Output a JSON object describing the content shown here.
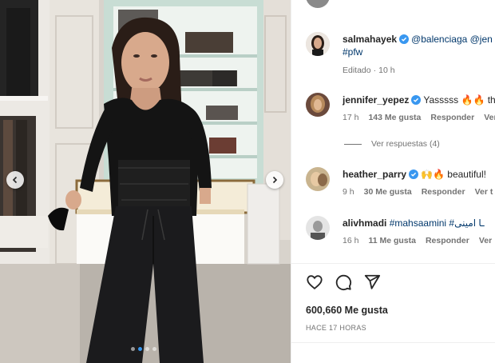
{
  "post": {
    "slides_total": 4,
    "slide_active": 1
  },
  "comments": [
    {
      "user": "salmahayek",
      "verified": true,
      "mentions": "@balenciaga @jen",
      "hashtag": "#pfw",
      "edited": "Editado",
      "time": "10 h"
    },
    {
      "user": "jennifer_yepez",
      "verified": true,
      "text": "Yasssss 🔥🔥 th",
      "time": "17 h",
      "likes": "143 Me gusta",
      "reply": "Responder",
      "more": "Ver"
    },
    {
      "user": "heather_parry",
      "verified": true,
      "text": "🙌🔥 beautiful!",
      "time": "9 h",
      "likes": "30 Me gusta",
      "reply": "Responder",
      "more": "Ver t"
    },
    {
      "user": "alivhmadi",
      "verified": false,
      "text": "#mahsaamini #ـا امینی",
      "time": "16 h",
      "likes": "11 Me gusta",
      "reply": "Responder",
      "more": "Ver"
    }
  ],
  "view_replies": "Ver respuestas (4)",
  "likes_total": "600,660 Me gusta",
  "posted_ago": "HACE 17 HORAS",
  "icons": [
    "heart-icon",
    "comment-icon",
    "share-icon",
    "chevron-left-icon",
    "chevron-right-icon",
    "verified-badge-icon"
  ],
  "colors": {
    "verified": "#3897f0",
    "mention": "#00376b",
    "meta": "#737373"
  }
}
